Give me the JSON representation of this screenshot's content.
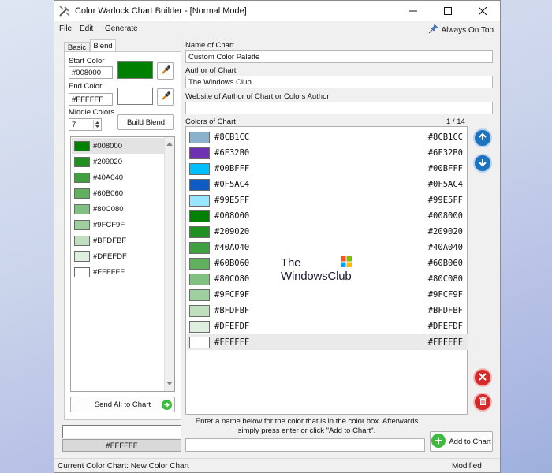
{
  "window": {
    "title": "Color Warlock Chart Builder - [Normal Mode]"
  },
  "menu": {
    "items": [
      "File",
      "Edit",
      "Generate"
    ],
    "always_on_top": "Always On Top"
  },
  "tabs": [
    "Basic",
    "Blend"
  ],
  "blend": {
    "start_color_label": "Start Color",
    "start_color_value": "#008000",
    "end_color_label": "End Color",
    "end_color_value": "#FFFFFF",
    "middle_colors_label": "Middle Colors",
    "middle_colors_value": "7",
    "build_blend_label": "Build Blend",
    "send_all_label": "Send All to Chart",
    "list": [
      {
        "hex": "#008000"
      },
      {
        "hex": "#209020"
      },
      {
        "hex": "#40A040"
      },
      {
        "hex": "#60B060"
      },
      {
        "hex": "#80C080"
      },
      {
        "hex": "#9FCF9F"
      },
      {
        "hex": "#BFDFBF"
      },
      {
        "hex": "#DFEFDF"
      },
      {
        "hex": "#FFFFFF"
      }
    ]
  },
  "preview": {
    "hex": "#FFFFFF"
  },
  "chart": {
    "name_label": "Name of Chart",
    "name_value": "Custom Color Palette",
    "author_label": "Author of Chart",
    "author_value": "The Windows Club",
    "website_label": "Website of Author of Chart or Colors Author",
    "website_value": "",
    "colors_label": "Colors of Chart",
    "counter": "1 / 14",
    "colors": [
      {
        "name": "#8CB1CC",
        "hex": "#8CB1CC"
      },
      {
        "name": "#6F32B0",
        "hex": "#6F32B0"
      },
      {
        "name": "#00BFFF",
        "hex": "#00BFFF"
      },
      {
        "name": "#0F5AC4",
        "hex": "#0F5AC4"
      },
      {
        "name": "#99E5FF",
        "hex": "#99E5FF"
      },
      {
        "name": "#008000",
        "hex": "#008000"
      },
      {
        "name": "#209020",
        "hex": "#209020"
      },
      {
        "name": "#40A040",
        "hex": "#40A040"
      },
      {
        "name": "#60B060",
        "hex": "#60B060"
      },
      {
        "name": "#80C080",
        "hex": "#80C080"
      },
      {
        "name": "#9FCF9F",
        "hex": "#9FCF9F"
      },
      {
        "name": "#BFDFBF",
        "hex": "#BFDFBF"
      },
      {
        "name": "#DFEFDF",
        "hex": "#DFEFDF"
      },
      {
        "name": "#FFFFFF",
        "hex": "#FFFFFF"
      }
    ],
    "instructions": "Enter a name below for the color that is in the color box. Afterwards simply press enter or click \"Add to Chart\".",
    "add_label": "Add to Chart",
    "new_color_name": ""
  },
  "watermark": {
    "line1": "The",
    "line2": "WindowsClub"
  },
  "status": {
    "current_chart": "Current Color Chart:  New Color Chart",
    "state": "Modified"
  },
  "colors": {
    "accent_blue": "#1e73be",
    "delete_red": "#d42a2a",
    "add_green": "#3dbb3d"
  }
}
